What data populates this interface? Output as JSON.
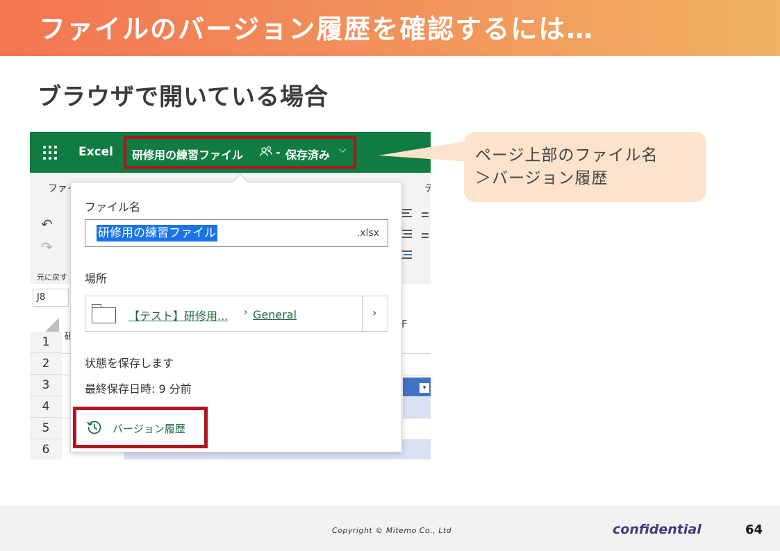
{
  "slide": {
    "title": "ファイルのバージョン履歴を確認するには…",
    "subtitle": "ブラウザで開いている場合",
    "colors": {
      "accent_start": "#f37552",
      "accent_end": "#f1b463",
      "excel_green": "#107c41",
      "highlight_red": "#b3131d",
      "callout_bg": "#fde3cc"
    }
  },
  "excel": {
    "app_name": "Excel",
    "waffle_icon": "app-launcher-icon",
    "file_title": "研修用の練習ファイル",
    "share_icon_glyph": "ᴥ",
    "separator": "-",
    "save_status": "保存済み",
    "dropdown_glyph": "⌵",
    "ribbon_tab_left": "ファイ",
    "ribbon_tab_right": "テ",
    "undo_glyph": "↶",
    "redo_glyph": "↷",
    "undo_label": "元に戻す",
    "name_box": "J8",
    "column_visible": "F",
    "rows": [
      "1",
      "2",
      "3",
      "4",
      "5",
      "6"
    ],
    "row1_cell": "研",
    "filter_glyph": "▾"
  },
  "popup": {
    "filename_label": "ファイル名",
    "filename_value": "研修用の練習ファイル",
    "extension": ".xlsx",
    "location_label": "場所",
    "location_site": "【テスト】研修用...",
    "location_sep": "›",
    "location_channel": "General",
    "location_chevron": "›",
    "status_text": "状態を保存します",
    "last_saved": "最終保存日時: 9 分前",
    "version_history": "バージョン履歴",
    "version_history_icon": "history-clock-icon"
  },
  "callout": {
    "line1": "ページ上部のファイル名",
    "line2": "＞バージョン履歴"
  },
  "footer": {
    "copyright": "Copyright © Mitemo Co., Ltd",
    "confidential": "confidential",
    "page_number": "64"
  }
}
